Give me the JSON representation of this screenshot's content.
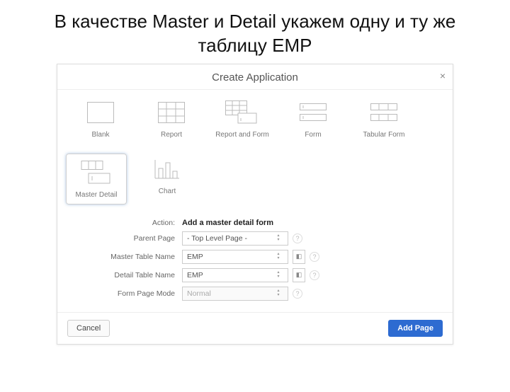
{
  "slide": {
    "title": "В качестве Master и Detail укажем одну и ту же таблицу EMP"
  },
  "dialog": {
    "title": "Create Application",
    "close": "×",
    "tiles": [
      {
        "label": "Blank"
      },
      {
        "label": "Report"
      },
      {
        "label": "Report and Form"
      },
      {
        "label": "Form"
      },
      {
        "label": "Tabular Form"
      },
      {
        "label": "Master Detail"
      },
      {
        "label": "Chart"
      }
    ],
    "form": {
      "action_label": "Action:",
      "action_value": "Add a master detail form",
      "parent_label": "Parent Page",
      "parent_value": "- Top Level Page -",
      "master_label": "Master Table Name",
      "master_value": "EMP",
      "detail_label": "Detail Table Name",
      "detail_value": "EMP",
      "mode_label": "Form Page Mode",
      "mode_value": "Normal"
    },
    "buttons": {
      "cancel": "Cancel",
      "add": "Add Page"
    }
  }
}
